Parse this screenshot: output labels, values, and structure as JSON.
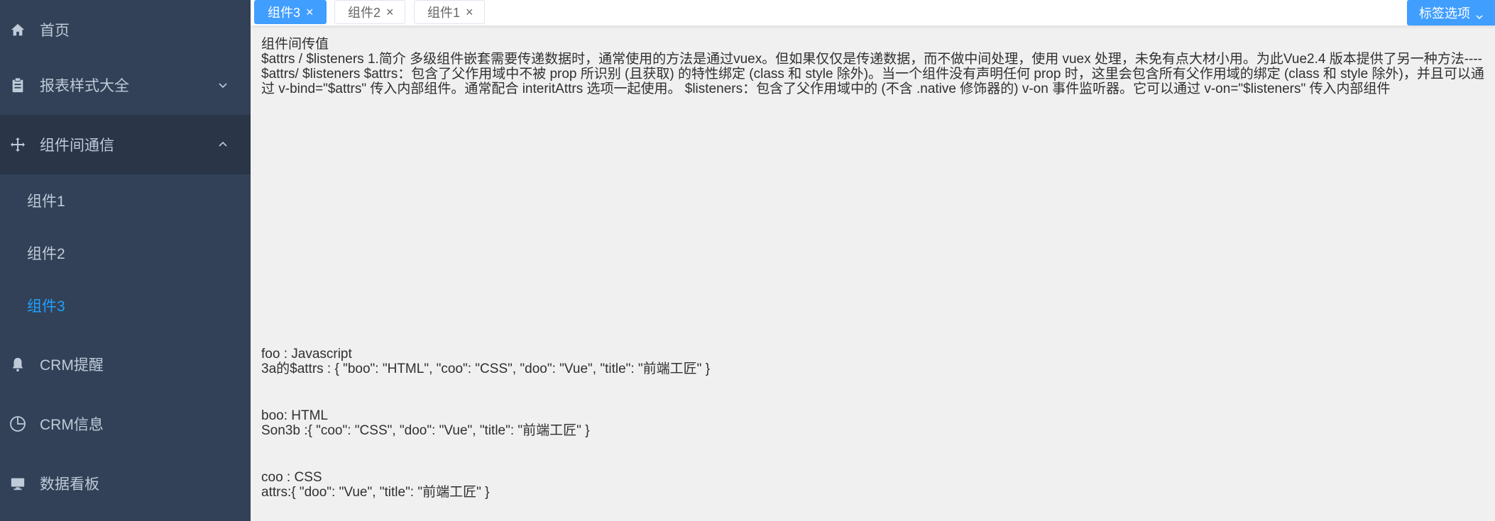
{
  "sidebar": {
    "items": [
      {
        "label": "首页",
        "icon": "home-icon"
      },
      {
        "label": "报表样式大全",
        "icon": "clipboard-icon"
      },
      {
        "label": "组件间通信",
        "icon": "move-icon"
      },
      {
        "label": "CRM提醒",
        "icon": "bell-icon"
      },
      {
        "label": "CRM信息",
        "icon": "pie-chart-icon"
      },
      {
        "label": "数据看板",
        "icon": "monitor-icon"
      }
    ],
    "subitems": [
      {
        "label": "组件1"
      },
      {
        "label": "组件2"
      },
      {
        "label": "组件3"
      }
    ]
  },
  "tags": [
    {
      "label": "组件3",
      "active": true
    },
    {
      "label": "组件2",
      "active": false
    },
    {
      "label": "组件1",
      "active": false
    }
  ],
  "tag_options_label": "标签选项",
  "content": {
    "title": "组件间传值",
    "description": "$attrs / $listeners 1.简介 多级组件嵌套需要传递数据时，通常使用的方法是通过vuex。但如果仅仅是传递数据，而不做中间处理，使用 vuex 处理，未免有点大材小用。为此Vue2.4 版本提供了另一种方法---- $attrs/ $listeners $attrs：包含了父作用域中不被 prop 所识别 (且获取) 的特性绑定 (class 和 style 除外)。当一个组件没有声明任何 prop 时，这里会包含所有父作用域的绑定 (class 和 style 除外)，并且可以通过 v-bind=\"$attrs\" 传入内部组件。通常配合 interitAttrs 选项一起使用。 $listeners：包含了父作用域中的 (不含 .native 修饰器的) v-on 事件监听器。它可以通过 v-on=\"$listeners\" 传入内部组件",
    "blocks": [
      {
        "line1": "foo : Javascript",
        "line2": "3a的$attrs : { \"boo\": \"HTML\", \"coo\": \"CSS\", \"doo\": \"Vue\", \"title\": \"前端工匠\" }"
      },
      {
        "line1": "boo: HTML",
        "line2": "Son3b :{ \"coo\": \"CSS\", \"doo\": \"Vue\", \"title\": \"前端工匠\" }"
      },
      {
        "line1": "coo : CSS",
        "line2": "attrs:{ \"doo\": \"Vue\", \"title\": \"前端工匠\" }"
      }
    ]
  },
  "colors": {
    "sidebar_bg": "#324157",
    "sidebar_text": "#bfcbd9",
    "active_text": "#20a0ff",
    "tag_active_bg": "#409eff"
  }
}
